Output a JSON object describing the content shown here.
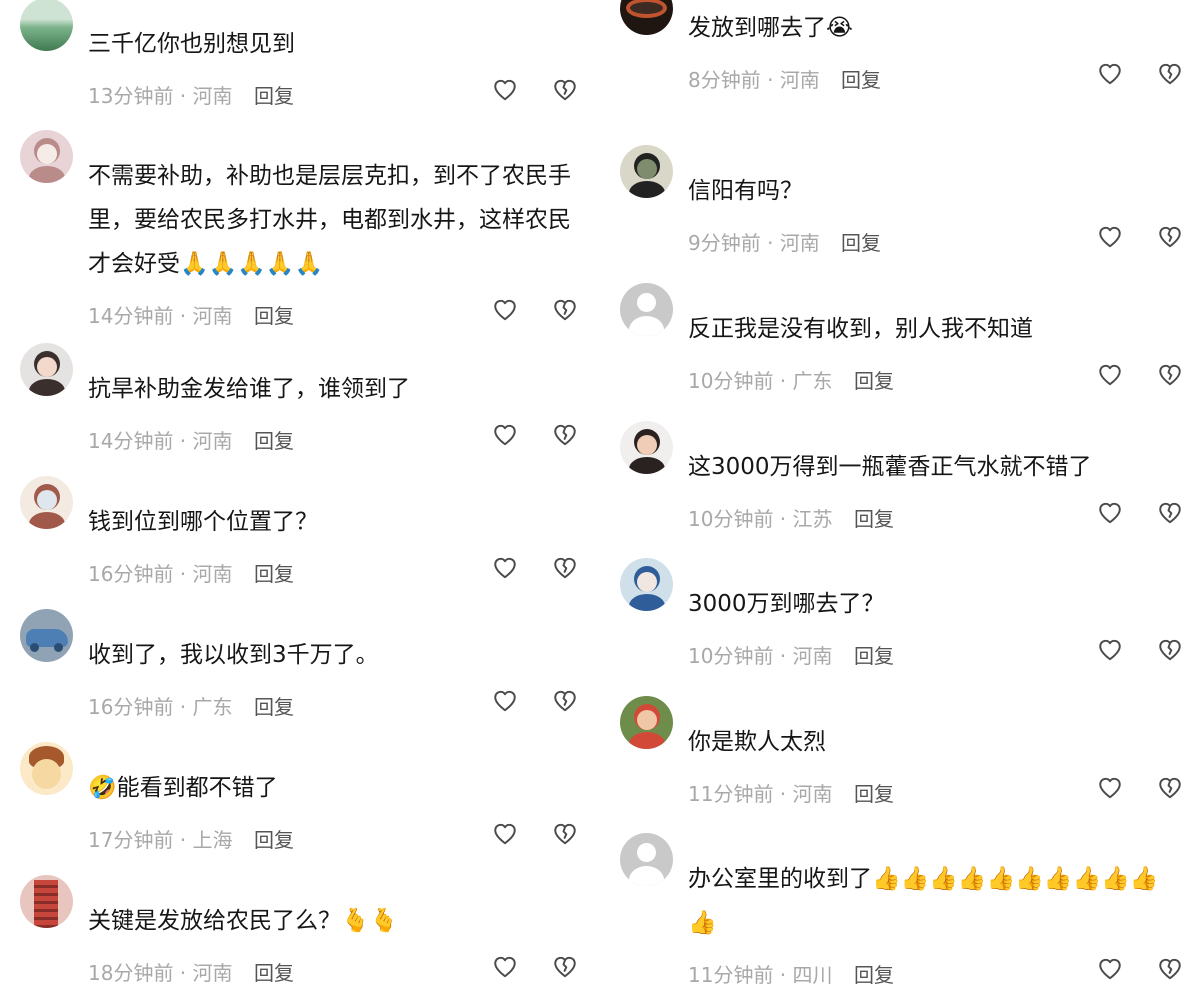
{
  "left_comments": [
    {
      "user": "",
      "text": "三千亿你也别想见到",
      "time": "13分钟前",
      "region": "河南",
      "reply": "回复",
      "avatar": {
        "style": "landscape",
        "colors": [
          "#7db48c",
          "#3f7a4f",
          "#cfe3d4"
        ]
      }
    },
    {
      "user": "",
      "text": "不需要补助，补助也是层层克扣，到不了农民手里，要给农民多打水井，电都到水井，这样农民才会好受🙏🙏🙏🙏🙏",
      "time": "14分钟前",
      "region": "河南",
      "reply": "回复",
      "avatar": {
        "style": "portrait",
        "colors": [
          "#e8d3d6",
          "#b98c8a",
          "#f5ece8"
        ]
      }
    },
    {
      "user": "",
      "text": "抗旱补助金发给谁了，谁领到了",
      "time": "14分钟前",
      "region": "河南",
      "reply": "回复",
      "avatar": {
        "style": "portrait",
        "colors": [
          "#e5e2e2",
          "#3b2f2e",
          "#f2d9cc"
        ]
      }
    },
    {
      "user": "",
      "text": "钱到位到哪个位置了？",
      "time": "16分钟前",
      "region": "河南",
      "reply": "回复",
      "avatar": {
        "style": "portrait",
        "colors": [
          "#f3ebe1",
          "#a15a4a",
          "#dfe6ee"
        ]
      }
    },
    {
      "user": "",
      "text": "收到了，我以收到3千万了。",
      "time": "16分钟前",
      "region": "广东",
      "reply": "回复",
      "avatar": {
        "style": "car",
        "colors": [
          "#4d7fb5",
          "#2b4c73",
          "#8fa3b4"
        ]
      }
    },
    {
      "user": "",
      "text": "🤣能看到都不错了",
      "time": "17分钟前",
      "region": "上海",
      "reply": "回复",
      "avatar": {
        "style": "cartoon",
        "colors": [
          "#f6d9a2",
          "#a5592c",
          "#fbe9c8"
        ]
      }
    },
    {
      "user": "",
      "text": "关键是发放给农民了么？🫰🫰",
      "time": "18分钟前",
      "region": "河南",
      "reply": "回复",
      "avatar": {
        "style": "building",
        "colors": [
          "#c7463c",
          "#8a2c27",
          "#e9c5bf"
        ]
      }
    }
  ],
  "right_comments": [
    {
      "user": "",
      "text": "发放到哪去了😭",
      "time": "8分钟前",
      "region": "河南",
      "reply": "回复",
      "avatar": {
        "style": "dark",
        "colors": [
          "#3d2a23",
          "#c0542e",
          "#1f1612"
        ]
      }
    },
    {
      "user": "",
      "text": "信阳有吗？",
      "time": "9分钟前",
      "region": "河南",
      "reply": "回复",
      "avatar": {
        "style": "portrait",
        "colors": [
          "#d9d7c8",
          "#222222",
          "#7f8d6e"
        ]
      }
    },
    {
      "user": "",
      "text": "反正我是没有收到，别人我不知道",
      "time": "10分钟前",
      "region": "广东",
      "reply": "回复",
      "avatar": {
        "style": "default",
        "colors": [
          "#c9c9c9",
          "#ffffff",
          "#ffffff"
        ]
      }
    },
    {
      "user": "",
      "text": "这3000万得到一瓶藿香正气水就不错了",
      "time": "10分钟前",
      "region": "江苏",
      "reply": "回复",
      "avatar": {
        "style": "portrait",
        "colors": [
          "#f1eeee",
          "#2a2220",
          "#f0cdb6"
        ]
      }
    },
    {
      "user": "",
      "text": "3000万到哪去了？",
      "time": "10分钟前",
      "region": "河南",
      "reply": "回复",
      "avatar": {
        "style": "portrait",
        "colors": [
          "#cfe0ea",
          "#2f5d9a",
          "#f1e7e2"
        ]
      }
    },
    {
      "user": "",
      "text": "你是欺人太烈",
      "time": "11分钟前",
      "region": "河南",
      "reply": "回复",
      "avatar": {
        "style": "portrait",
        "colors": [
          "#6e8d4b",
          "#d24a37",
          "#f0c8a8"
        ]
      }
    },
    {
      "user": "",
      "text": "办公室里的收到了👍👍👍👍👍👍👍👍👍👍👍",
      "time": "11分钟前",
      "region": "四川",
      "reply": "回复",
      "avatar": {
        "style": "default",
        "colors": [
          "#c9c9c9",
          "#ffffff",
          "#ffffff"
        ]
      }
    }
  ],
  "icons": {
    "like": "heart-outline-icon",
    "dislike": "broken-heart-outline-icon"
  },
  "colors": {
    "text": "#161616",
    "meta": "#a8a8a8",
    "reply": "#555555",
    "icon": "#4a4a4a",
    "background": "#ffffff"
  }
}
